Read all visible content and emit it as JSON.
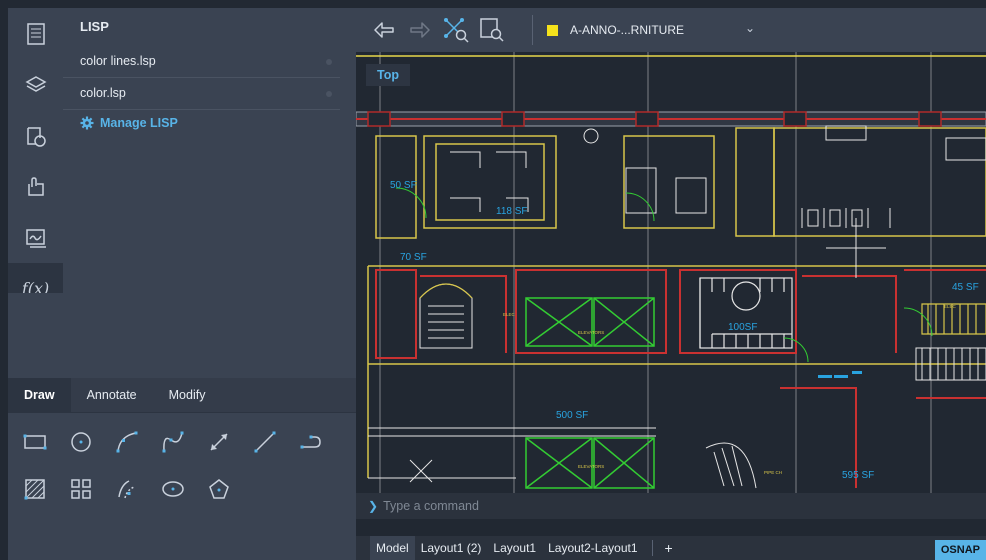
{
  "lisp_panel": {
    "title": "LISP",
    "files": [
      {
        "label": "color lines.lsp"
      },
      {
        "label": "color.lsp"
      }
    ],
    "manage_label": "Manage LISP"
  },
  "rail": {
    "icons": [
      "properties-icon",
      "layers-icon",
      "blocks-icon",
      "xrefs-icon",
      "images-icon",
      "lisp-fx-icon"
    ],
    "fx_label": "f(x)"
  },
  "tool_tabs": [
    {
      "label": "Draw",
      "active": true
    },
    {
      "label": "Annotate",
      "active": false
    },
    {
      "label": "Modify",
      "active": false
    }
  ],
  "draw_tools_row1": [
    "rectangle-icon",
    "circle-icon",
    "arc-icon",
    "spline-icon",
    "dimension-icon",
    "line-icon",
    "polyline-icon"
  ],
  "draw_tools_row2": [
    "hatch-icon",
    "array-icon",
    "offset-icon",
    "ellipse-icon",
    "polygon-icon"
  ],
  "toolbar": {
    "icons": [
      "undo-icon",
      "redo-icon",
      "zoom-extents-icon",
      "zoom-window-icon"
    ],
    "layer": {
      "name": "A-ANNO-...RNITURE",
      "color": "#f5e21b"
    }
  },
  "view_label": "Top",
  "drawing": {
    "area_labels": [
      "50 SF",
      "118 SF",
      "70 SF",
      "100SF",
      "45 SF",
      "500 SF",
      "595 SF"
    ],
    "small_labels": [
      "ELEVATORS",
      "ELEVATORS",
      "ELEC",
      "ELEC",
      "PIPE CH"
    ]
  },
  "command": {
    "prompt": ">",
    "placeholder": "Type a command"
  },
  "layout_tabs": [
    {
      "label": "Model",
      "active": true
    },
    {
      "label": "Layout1 (2)",
      "active": false
    },
    {
      "label": "Layout1",
      "active": false
    },
    {
      "label": "Layout2-Layout1",
      "active": false
    }
  ],
  "add_layout_label": "+",
  "status": {
    "osnap_label": "OSNAP"
  },
  "colors": {
    "accent": "#58b4e8",
    "panel": "#3a4352",
    "canvas": "#212832"
  }
}
